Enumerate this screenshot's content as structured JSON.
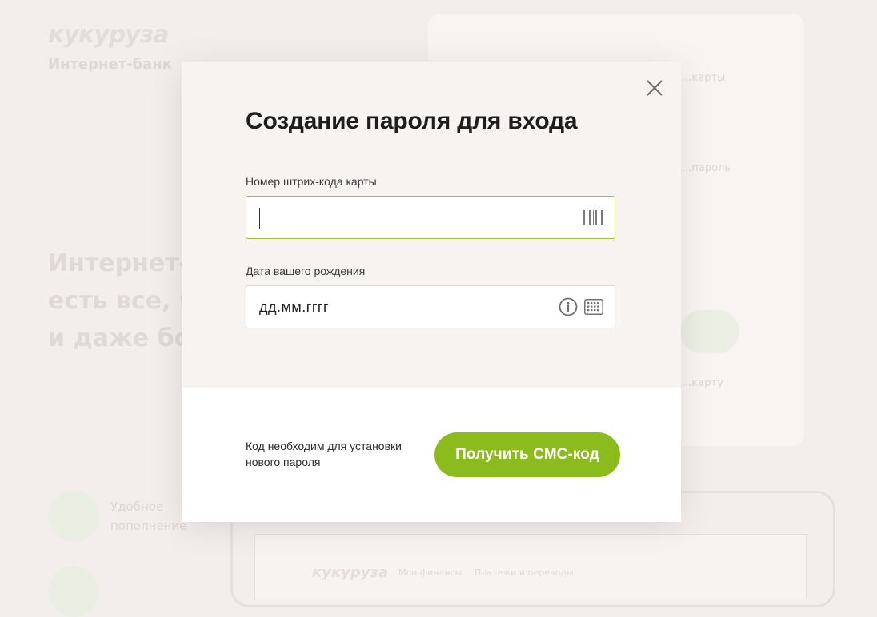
{
  "background": {
    "logo": "кукуруза",
    "logo_sub": "Интернет-банк",
    "hero_lines": [
      "Интернет-б",
      "есть все, чт",
      "и даже бол"
    ],
    "link": "... ",
    "card_lines": [
      "...карты",
      "...пароль",
      "...карту"
    ],
    "features": [
      {
        "text_line1": "Удобное",
        "text_line2": "пополнение"
      },
      {
        "text_line1": "",
        "text_line2": ""
      }
    ],
    "mini_logo": "кукуруза",
    "mini_nav": [
      "Мои финансы",
      "Платежи и переводы"
    ]
  },
  "modal": {
    "title": "Создание пароля для входа",
    "barcode_field": {
      "label": "Номер штрих-кода карты",
      "value": "",
      "placeholder": ""
    },
    "birthdate_field": {
      "label": "Дата вашего рождения",
      "value": "",
      "placeholder": "дд.мм.гггг"
    },
    "footer_note": "Код необходим для установки нового пароля",
    "submit_label": "Получить СМС-код"
  },
  "colors": {
    "accent": "#8cbb1e",
    "focus_border": "#9ec23c",
    "overlay_bg": "#f3eeec"
  },
  "icons": [
    "close-icon",
    "barcode-icon",
    "info-icon",
    "keyboard-icon"
  ]
}
